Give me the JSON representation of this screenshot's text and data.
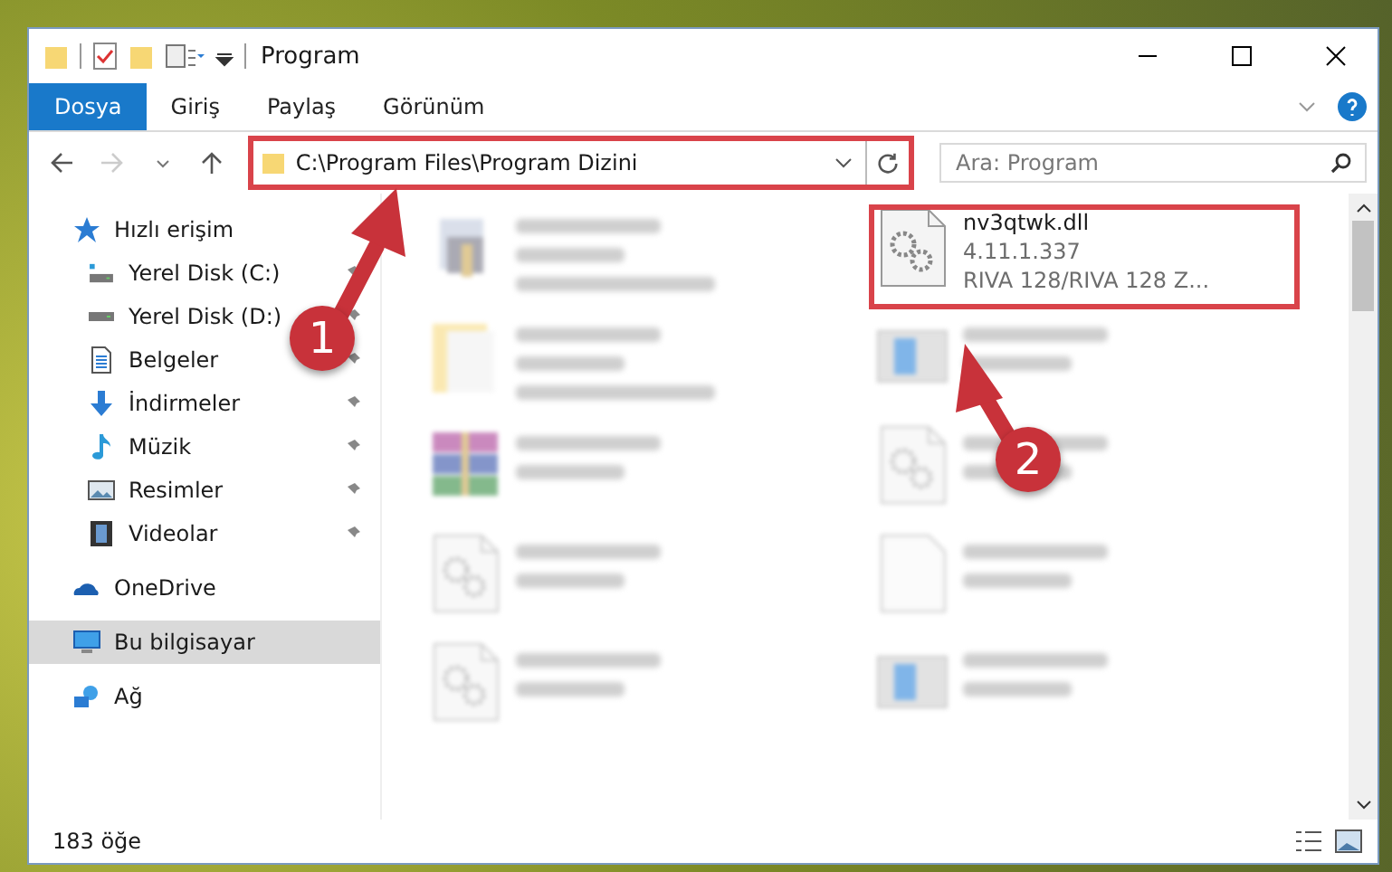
{
  "window": {
    "title": "Program"
  },
  "ribbon_tabs": [
    {
      "label": "Dosya",
      "selected": true
    },
    {
      "label": "Giriş",
      "selected": false
    },
    {
      "label": "Paylaş",
      "selected": false
    },
    {
      "label": "Görünüm",
      "selected": false
    }
  ],
  "address_bar": {
    "value": "C:\\Program Files\\Program Dizini",
    "highlighted": true
  },
  "search": {
    "placeholder": "Ara: Program"
  },
  "sidebar": {
    "items": [
      {
        "label": "Hızlı erişim",
        "kind": "star",
        "selected": false,
        "children": [
          {
            "label": "Yerel Disk (C:)",
            "kind": "drive-c",
            "pinned": true,
            "selected": false
          },
          {
            "label": "Yerel Disk (D:)",
            "kind": "drive",
            "pinned": true,
            "selected": false
          },
          {
            "label": "Belgeler",
            "kind": "document",
            "pinned": true,
            "selected": false
          },
          {
            "label": "İndirmeler",
            "kind": "download",
            "pinned": true,
            "selected": false
          },
          {
            "label": "Müzik",
            "kind": "music",
            "pinned": true,
            "selected": false
          },
          {
            "label": "Resimler",
            "kind": "pictures",
            "pinned": true,
            "selected": false
          },
          {
            "label": "Videolar",
            "kind": "video",
            "pinned": true,
            "selected": false
          }
        ]
      },
      {
        "label": "OneDrive",
        "kind": "cloud",
        "selected": false
      },
      {
        "label": "Bu bilgisayar",
        "kind": "computer",
        "selected": true
      },
      {
        "label": "Ağ",
        "kind": "network",
        "selected": false
      }
    ]
  },
  "files": [
    {
      "kind": "exe",
      "faded": true,
      "highlighted": false
    },
    {
      "name": "nv3qtwk.dll",
      "details": [
        "4.11.1.337",
        "RIVA 128/RIVA 128  Z..."
      ],
      "kind": "dll",
      "faded": false,
      "highlighted": true
    },
    {
      "kind": "folder",
      "faded": true,
      "highlighted": false
    },
    {
      "kind": "installer",
      "faded": true,
      "highlighted": false
    },
    {
      "kind": "archive",
      "faded": true,
      "highlighted": false
    },
    {
      "kind": "dll",
      "faded": true,
      "highlighted": false
    },
    {
      "kind": "dll",
      "faded": true,
      "highlighted": false
    },
    {
      "kind": "blank",
      "faded": true,
      "highlighted": false
    },
    {
      "kind": "dll",
      "faded": true,
      "highlighted": false
    },
    {
      "kind": "installer",
      "faded": true,
      "highlighted": false
    }
  ],
  "status_bar": {
    "item_count": "183 öğe"
  },
  "callouts": [
    {
      "label": "1"
    },
    {
      "label": "2"
    }
  ]
}
